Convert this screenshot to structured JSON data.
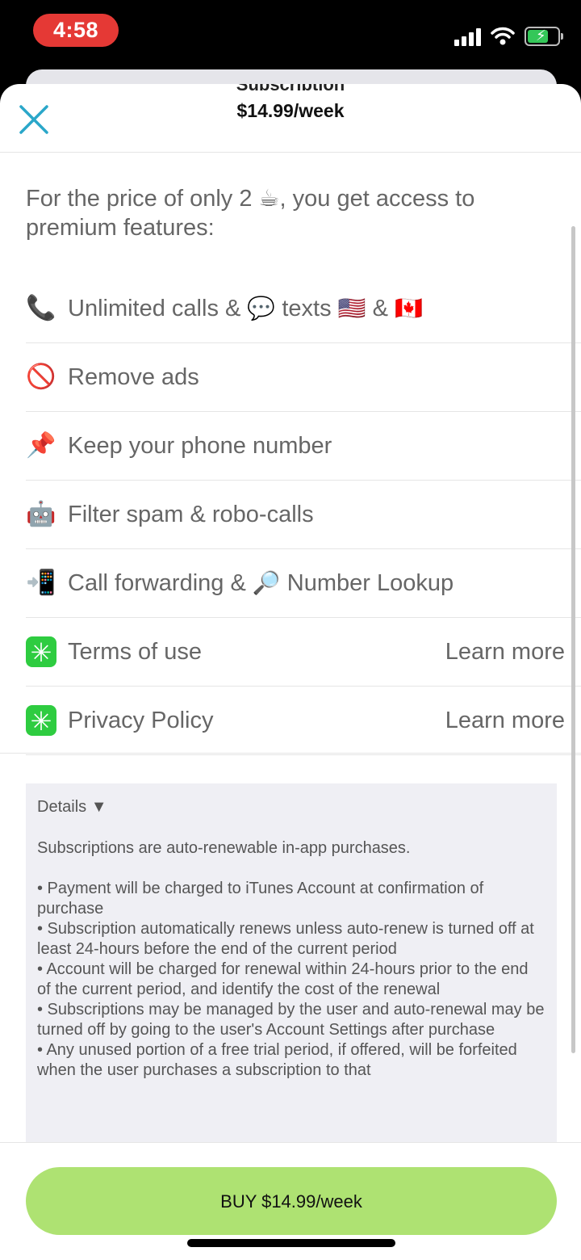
{
  "status_bar": {
    "time": "4:58"
  },
  "header": {
    "subtitle": "Subscription",
    "title": "$14.99/week"
  },
  "intro": "For the price of only 2 ☕, you get access to premium features:",
  "features": [
    {
      "icon": "📞",
      "parts": [
        "Unlimited calls & ",
        "💬",
        " texts ",
        "🇺🇸",
        " & ",
        "🇨🇦"
      ]
    },
    {
      "icon": "🚫",
      "label": "Remove ads"
    },
    {
      "icon": "📌",
      "label": "Keep your phone number"
    },
    {
      "icon": "🤖",
      "label": "Filter spam & robo-calls"
    },
    {
      "icon": "📲",
      "parts": [
        "Call forwarding & ",
        "🔎",
        " Number Lookup"
      ]
    },
    {
      "icon": "✳",
      "label": "Terms of use",
      "link": "Learn more"
    },
    {
      "icon": "✳",
      "label": "Privacy Policy",
      "link": "Learn more"
    }
  ],
  "details": {
    "toggle": "Details ▼",
    "intro": "Subscriptions are auto-renewable in-app purchases.",
    "bullets": [
      "• Payment will be charged to iTunes Account at confirmation of purchase",
      "• Subscription automatically renews unless auto-renew is turned off at least 24-hours before the end of the current period",
      "• Account will be charged for renewal within 24-hours prior to the end of the current period, and identify the cost of the renewal",
      "• Subscriptions may be managed by the user and auto-renewal may be turned off by going to the user's Account Settings after purchase",
      "• Any unused portion of a free trial period, if offered, will be forfeited when the user purchases a subscription to that"
    ]
  },
  "buy_button": "BUY $14.99/week",
  "colors": {
    "accent": "#2aa7c9",
    "buy": "#aee272",
    "time_pill": "#e53935"
  }
}
